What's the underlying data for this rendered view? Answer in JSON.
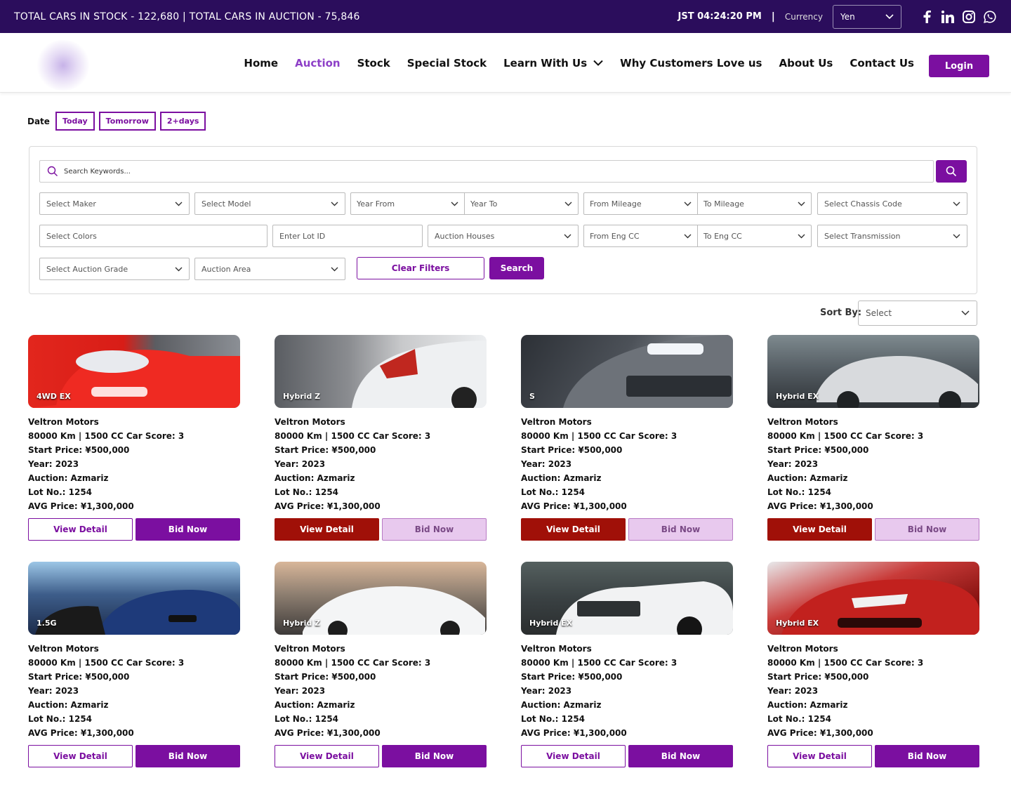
{
  "topbar": {
    "stock_text": "TOTAL CARS IN STOCK - 122,680 | TOTAL CARS IN AUCTION - 75,846",
    "clock": "JST 04:24:20 PM",
    "sep": "|",
    "currency_label": "Currency",
    "currency_value": "Yen",
    "social": [
      "facebook-icon",
      "linkedin-icon",
      "instagram-icon",
      "whatsapp-icon"
    ]
  },
  "nav": {
    "items": [
      "Home",
      "Auction",
      "Stock",
      "Special Stock",
      "Learn With Us",
      "Why Customers Love us",
      "About Us",
      "Contact Us"
    ],
    "active": "Auction",
    "login": "Login"
  },
  "date": {
    "label": "Date",
    "options": [
      "Today",
      "Tomorrow",
      "2+days"
    ]
  },
  "filters": {
    "search_placeholder": "Search Keywords...",
    "maker": "Select Maker",
    "model": "Select Model",
    "year_from": "Year From",
    "year_to": "Year To",
    "from_mileage": "From Mileage",
    "to_mileage": "To Mileage",
    "chassis": "Select Chassis Code",
    "colors": "Select Colors",
    "lot_id": "Enter Lot ID",
    "auction_houses": "Auction Houses",
    "from_cc": "From Eng CC",
    "to_cc": "To Eng CC",
    "transmission": "Select Transmission",
    "grade": "Select Auction Grade",
    "area": "Auction Area",
    "clear": "Clear Filters",
    "search": "Search"
  },
  "sort": {
    "label": "Sort By:",
    "value": "Select"
  },
  "colors": {
    "brand": "#7b0fa0",
    "topbar": "#2b0d5c",
    "view_detail_alt": "#a01008",
    "bid_light": "#e8c9ee"
  },
  "cards": [
    {
      "tag": "4WD EX",
      "company": "Veltron Motors",
      "specs": "80000 Km | 1500 CC Car Score: 3",
      "start": "Start Price: ¥500,000",
      "year": "Year: 2023",
      "auction": "Auction: Azmariz",
      "lot": "Lot No.: 1254",
      "avg": "AVG Price: ¥1,300,000",
      "view": "View Detail",
      "bid": "Bid Now"
    },
    {
      "tag": "Hybrid Z",
      "company": "Veltron Motors",
      "specs": "80000 Km | 1500 CC Car Score: 3",
      "start": "Start Price: ¥500,000",
      "year": "Year: 2023",
      "auction": "Auction: Azmariz",
      "lot": "Lot No.: 1254",
      "avg": "AVG Price: ¥1,300,000",
      "view": "View Detail",
      "bid": "Bid Now"
    },
    {
      "tag": "S",
      "company": "Veltron Motors",
      "specs": "80000 Km | 1500 CC Car Score: 3",
      "start": "Start Price: ¥500,000",
      "year": "Year: 2023",
      "auction": "Auction: Azmariz",
      "lot": "Lot No.: 1254",
      "avg": "AVG Price: ¥1,300,000",
      "view": "View Detail",
      "bid": "Bid Now"
    },
    {
      "tag": "Hybrid EX",
      "company": "Veltron Motors",
      "specs": "80000 Km | 1500 CC Car Score: 3",
      "start": "Start Price: ¥500,000",
      "year": "Year: 2023",
      "auction": "Auction: Azmariz",
      "lot": "Lot No.: 1254",
      "avg": "AVG Price: ¥1,300,000",
      "view": "View Detail",
      "bid": "Bid Now"
    },
    {
      "tag": "1.5G",
      "company": "Veltron Motors",
      "specs": "80000 Km | 1500 CC Car Score: 3",
      "start": "Start Price: ¥500,000",
      "year": "Year: 2023",
      "auction": "Auction: Azmariz",
      "lot": "Lot No.: 1254",
      "avg": "AVG Price: ¥1,300,000",
      "view": "View Detail",
      "bid": "Bid Now"
    },
    {
      "tag": "Hybrid Z",
      "company": "Veltron Motors",
      "specs": "80000 Km | 1500 CC Car Score: 3",
      "start": "Start Price: ¥500,000",
      "year": "Year: 2023",
      "auction": "Auction: Azmariz",
      "lot": "Lot No.: 1254",
      "avg": "AVG Price: ¥1,300,000",
      "view": "View Detail",
      "bid": "Bid Now"
    },
    {
      "tag": "Hybrid EX",
      "company": "Veltron Motors",
      "specs": "80000 Km | 1500 CC Car Score: 3",
      "start": "Start Price: ¥500,000",
      "year": "Year: 2023",
      "auction": "Auction: Azmariz",
      "lot": "Lot No.: 1254",
      "avg": "AVG Price: ¥1,300,000",
      "view": "View Detail",
      "bid": "Bid Now"
    },
    {
      "tag": "Hybrid EX",
      "company": "Veltron Motors",
      "specs": "80000 Km | 1500 CC Car Score: 3",
      "start": "Start Price: ¥500,000",
      "year": "Year: 2023",
      "auction": "Auction: Azmariz",
      "lot": "Lot No.: 1254",
      "avg": "AVG Price: ¥1,300,000",
      "view": "View Detail",
      "bid": "Bid Now"
    }
  ]
}
